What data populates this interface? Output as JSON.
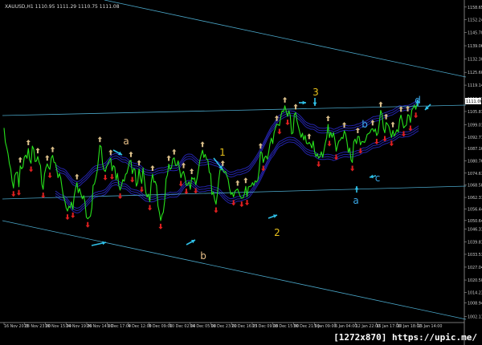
{
  "header": {
    "symbol": "XAUUSD,H1",
    "ohlc": "1110.95 1111.29 1110.75 1111.08"
  },
  "watermark": "[1272x870] https://upic.me/",
  "chart_data": {
    "type": "line",
    "title": "XAUUSD,H1",
    "series": [
      {
        "values": [
          1097.5,
          1090.2,
          1087.5,
          1084.4,
          1079.4,
          1076.6,
          1070.5,
          1067.1,
          1073.4,
          1074.9,
          1075.1,
          1067.7,
          1078.3,
          1076.8,
          1077.6,
          1082.6,
          1083.7,
          1082.1,
          1087.1,
          1081.3,
          1079.6,
          1088.3,
          1086.7,
          1080.5,
          1080.7,
          1083.0,
          1080.1,
          1078.4,
          1068.9,
          1066.4,
          1074.2,
          1077.3,
          1079.3,
          1077.4,
          1076.5,
          1082.2,
          1083.6,
          1080.1,
          1079.8,
          1076.5,
          1072.3,
          1074.4,
          1072.1,
          1067.1,
          1062.6,
          1060.8,
          1057.1,
          1055.4,
          1057.8,
          1057.1,
          1060.0,
          1056.3,
          1063.2,
          1066.9,
          1069.8,
          1064.7,
          1066.8,
          1063.9,
          1061.6,
          1063.2,
          1059.8,
          1052.3,
          1051.5,
          1052.2,
          1052.8,
          1057.0,
          1068.4,
          1069.1,
          1072.1,
          1075.7,
          1082.3,
          1088.7,
          1087.9,
          1079.3,
          1076.2,
          1075.4,
          1077.9,
          1079.3,
          1081.0,
          1082.1,
          1075.8,
          1078.4,
          1077.7,
          1071.3,
          1074.5,
          1068.4,
          1066.0,
          1068.3,
          1071.3,
          1070.5,
          1074.0,
          1074.6,
          1077.4,
          1080.7,
          1081.1,
          1074.3,
          1076.9,
          1076.4,
          1068.0,
          1069.7,
          1076.8,
          1072.1,
          1069.4,
          1077.3,
          1071.1,
          1064.8,
          1062.5,
          1064.0,
          1060.1,
          1069.9,
          1074.1,
          1070.0,
          1070.4,
          1068.3,
          1058.1,
          1055.0,
          1050.6,
          1053.5,
          1054.8,
          1060.6,
          1071.6,
          1073.7,
          1079.2,
          1076.5,
          1077.2,
          1081.7,
          1082.4,
          1078.6,
          1078.5,
          1080.8,
          1076.6,
          1072.3,
          1074.6,
          1075.5,
          1072.6,
          1068.4,
          1068.8,
          1070.2,
          1066.4,
          1072.5,
          1071.5,
          1072.2,
          1068.7,
          1072.1,
          1076.3,
          1080.9,
          1083.7,
          1086.2,
          1082.5,
          1084.1,
          1081.8,
          1081.1,
          1075.1,
          1074.2,
          1063.7,
          1065.1,
          1061.3,
          1058.9,
          1064.1,
          1070.9,
          1076.4,
          1076.3,
          1076.6,
          1074.9,
          1075.5,
          1073.3,
          1071.4,
          1066.8,
          1063.8,
          1064.8,
          1062.6,
          1065.4,
          1066.1,
          1066.6,
          1064.6,
          1062.8,
          1061.9,
          1062.1,
          1064.0,
          1067.9,
          1062.7,
          1067.6,
          1067.9,
          1068.1,
          1069.8,
          1068.4,
          1070.7,
          1070.1,
          1071.2,
          1076.6,
          1085.4,
          1084.9,
          1080.0,
          1082.5,
          1083.3,
          1081.7,
          1085.1,
          1089.5,
          1092.3,
          1089.6,
          1095.1,
          1097.3,
          1099.4,
          1099.1,
          1098.7,
          1103.4,
          1106.1,
          1105.7,
          1108.7,
          1105.9,
          1103.3,
          1106.2,
          1103.8,
          1094.4,
          1095.0,
          1104.3,
          1105.2,
          1101.0,
          1098.2,
          1095.3,
          1092.7,
          1094.8,
          1091.4,
          1093.7,
          1089.7,
          1089.4,
          1090.2,
          1089.2,
          1087.3,
          1090.8,
          1085.5,
          1083.0,
          1084.5,
          1082.2,
          1082.9,
          1085.4,
          1082.6,
          1086.0,
          1089.9,
          1092.7,
          1099.3,
          1092.6,
          1095.3,
          1092.7,
          1095.1,
          1091.5,
          1085.7,
          1088.7,
          1090.9,
          1091.3,
          1092.7,
          1092.1,
          1096.0,
          1094.5,
          1090.5,
          1085.1,
          1087.3,
          1081.2,
          1080.0,
          1090.4,
          1091.8,
          1089.5,
          1093.2,
          1093.1,
          1088.9,
          1090.6,
          1090.5,
          1090.1,
          1091.6,
          1094.2,
          1094.6,
          1095.1,
          1096.8,
          1097.1,
          1095.6,
          1097.0,
          1093.6,
          1094.9,
          1100.4,
          1106.4,
          1104.3,
          1097.2,
          1095.0,
          1100.2,
          1099.5,
          1098.3,
          1095.5,
          1092.7,
          1096.2,
          1093.3,
          1094.9,
          1096.6,
          1095.4,
          1101.6,
          1104.0,
          1100.8,
          1097.5,
          1098.3,
          1098.9,
          1104.2,
          1103.8,
          1100.3,
          1106.5,
          1107.6,
          1109.0,
          1106.9,
          1110.2,
          1111.1
        ]
      }
    ],
    "x_ticks": [
      "16 Nov 2015",
      "18 Nov 23:00",
      "20 Nov 15:00",
      "24 Nov 19:00",
      "26 Nov 14:00",
      "1 Dec 17:00",
      "4 Dec 12:00",
      "8 Dec 09:00",
      "10 Dec 02:00",
      "14 Dec 05:00",
      "16 Dec 23:00",
      "21 Dec 16:05",
      "23 Dec 09:00",
      "28 Dec 15:00",
      "30 Dec 21:00",
      "5 Jan 09:00",
      "6 Jan 04:00",
      "12 Jan 22:00",
      "15 Jan 17:00",
      "20 Jan 18:00",
      "25 Jan 14:00"
    ],
    "y_ticks": [
      "1158.65",
      "1152.24",
      "1145.70",
      "1139.06",
      "1132.30",
      "1125.60",
      "1119.14",
      "1112.31",
      "1105.81",
      "1099.01",
      "1092.71",
      "1087.16",
      "1080.76",
      "1074.61",
      "1068.58",
      "1062.31",
      "1056.44",
      "1050.64",
      "1046.31",
      "1039.81",
      "1033.53",
      "1027.04",
      "1020.50",
      "1014.23",
      "1008.94",
      "1002.11"
    ],
    "current_price": "1111.06",
    "ylim": [
      999,
      1161
    ],
    "wave_labels": [
      {
        "text": "a",
        "color": "#e8c089"
      },
      {
        "text": "b",
        "color": "#e8c089"
      },
      {
        "text": "1",
        "color": "#e8c21c"
      },
      {
        "text": "2",
        "color": "#e8c21c"
      },
      {
        "text": "3",
        "color": "#e8c21c"
      },
      {
        "text": "a",
        "color": "#3aa8e8"
      },
      {
        "text": "b",
        "color": "#3aa8e8"
      },
      {
        "text": "c",
        "color": "#3aa8e8"
      },
      {
        "text": "d",
        "color": "#3aa8e8"
      }
    ],
    "colors": {
      "background": "#000000",
      "price_line": "#27e21b",
      "channel": "#4aa6c8",
      "envelope": "#2323a8",
      "fractal_up": "#e02020",
      "fractal_down": "#dcc08a",
      "wave_arrow": "#2fc0e8"
    }
  }
}
